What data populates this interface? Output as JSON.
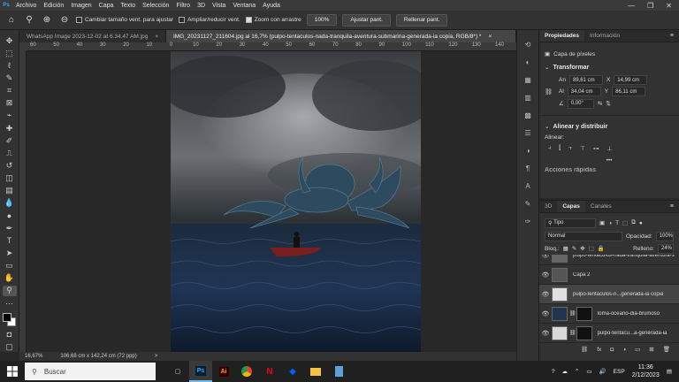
{
  "menu": [
    "Archivo",
    "Edición",
    "Imagen",
    "Capa",
    "Texto",
    "Selección",
    "Filtro",
    "3D",
    "Vista",
    "Ventana",
    "Ayuda"
  ],
  "app_logo": "Ps",
  "options_bar": {
    "resize_windows_label": "Cambiar tamaño vent. para ajustar",
    "zoom_all_label": "Ampliar/reducir vent.",
    "scrubby_zoom_label": "Zoom con arrastre",
    "zoom_value": "100%",
    "fit_screen_label": "Ajustar pant.",
    "fill_screen_label": "Rellenar pant."
  },
  "tabs": [
    {
      "label": "WhatsApp Image 2023-12-02 at 6.34.47 AM.jpg",
      "close": "×"
    },
    {
      "label": "IMG_20231127_211604.jpg al 16,7% (pulpo-tentaculos-nada-tranquila-aventura-submarina-generada-ia copia, RGB/8*) *",
      "close": "×"
    }
  ],
  "ruler_ticks": [
    "60",
    "50",
    "40",
    "30",
    "20",
    "10",
    "0",
    "10",
    "20",
    "30",
    "40",
    "50",
    "60",
    "70",
    "80",
    "90",
    "100",
    "110",
    "120",
    "130",
    "140"
  ],
  "status": {
    "zoom": "16,67%",
    "size": "106,68 cm x 142,24 cm (72 ppp)",
    "arrow": ">"
  },
  "properties": {
    "tab_active": "Propiedades",
    "tab_other": "Información",
    "layer_type": "Capa de píxeles",
    "transform_title": "Transformar",
    "w_label": "An",
    "w_value": "89,61 cm",
    "x_label": "X",
    "x_value": "14,99 cm",
    "h_label": "Al",
    "h_value": "34,04 cm",
    "y_label": "Y",
    "y_value": "86,11 cm",
    "angle_value": "0,00°",
    "align_title": "Alinear y distribuir",
    "align_label": "Alinear:",
    "more": "•••",
    "cut_text": "Acciones rápidas"
  },
  "layers": {
    "tab_3d": "3D",
    "tab_active": "Capas",
    "tab_channels": "Canales",
    "filter_kind": "Tipo",
    "blend_mode": "Normal",
    "opacity_label": "Opacidad:",
    "opacity_value": "100%",
    "lock_label": "Bloq.:",
    "fill_label": "Relleno:",
    "fill_value": "24%",
    "rows": [
      {
        "name": "pulpo-tentaculos-nada-tranquila-aventura-s"
      },
      {
        "name": "Capa 2"
      },
      {
        "name": "pulpo-tentaculos-n...generada-ia copia"
      },
      {
        "name": "toma-oceano-dia-brumoso"
      },
      {
        "name": "pulpo-tentacu...a-generada-ia"
      }
    ]
  },
  "taskbar": {
    "search_placeholder": "Buscar",
    "lang": "ESP",
    "time": "11:36",
    "date": "2/12/2023",
    "apps": [
      "Ps",
      "Ai"
    ]
  },
  "colors": {
    "accent": "#31a8ff",
    "panel": "#323232",
    "canvas_bg": "#282828"
  }
}
